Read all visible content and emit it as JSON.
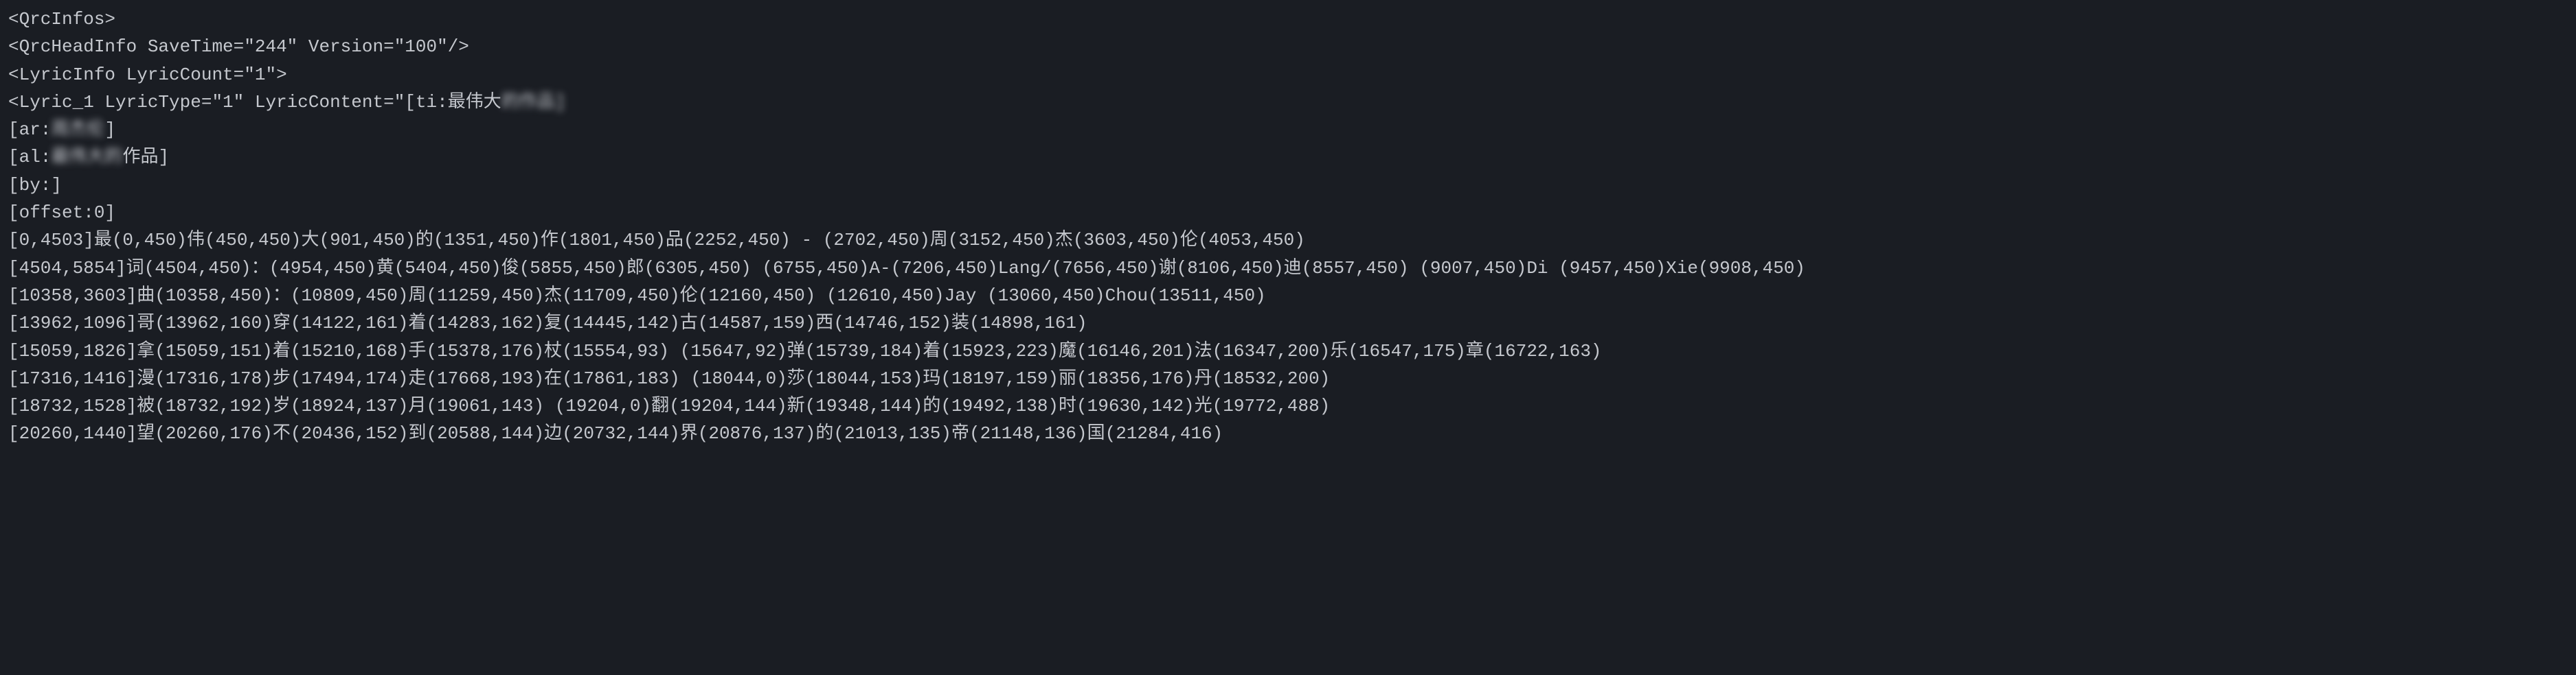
{
  "lines": {
    "l1": "<QrcInfos>",
    "l2": "<QrcHeadInfo SaveTime=\"244\" Version=\"100\"/>",
    "l3": "<LyricInfo LyricCount=\"1\">",
    "l4a": "<Lyric_1 LyricType=\"1\" LyricContent=\"[ti:最伟大",
    "l4b": "的作品]",
    "l5a": "[ar:",
    "l5b": "周杰伦",
    "l5c": "]",
    "l6a": "[al:",
    "l6b": "最伟大的",
    "l6c": "作品]",
    "l7": "[by:]",
    "l8": "[offset:0]",
    "l9": "[0,4503]最(0,450)伟(450,450)大(901,450)的(1351,450)作(1801,450)品(2252,450) - (2702,450)周(3152,450)杰(3603,450)伦(4053,450)",
    "l10": "[4504,5854]词(4504,450)：(4954,450)黄(5404,450)俊(5855,450)郎(6305,450) (6755,450)A-(7206,450)Lang/(7656,450)谢(8106,450)迪(8557,450) (9007,450)Di (9457,450)Xie(9908,450)",
    "l11": "[10358,3603]曲(10358,450)：(10809,450)周(11259,450)杰(11709,450)伦(12160,450) (12610,450)Jay (13060,450)Chou(13511,450)",
    "l12": "[13962,1096]哥(13962,160)穿(14122,161)着(14283,162)复(14445,142)古(14587,159)西(14746,152)装(14898,161)",
    "l13": "[15059,1826]拿(15059,151)着(15210,168)手(15378,176)杖(15554,93) (15647,92)弹(15739,184)着(15923,223)魔(16146,201)法(16347,200)乐(16547,175)章(16722,163)",
    "l14": "[17316,1416]漫(17316,178)步(17494,174)走(17668,193)在(17861,183) (18044,0)莎(18044,153)玛(18197,159)丽(18356,176)丹(18532,200)",
    "l15": "[18732,1528]被(18732,192)岁(18924,137)月(19061,143) (19204,0)翻(19204,144)新(19348,144)的(19492,138)时(19630,142)光(19772,488)",
    "l16": "[20260,1440]望(20260,176)不(20436,152)到(20588,144)边(20732,144)界(20876,137)的(21013,135)帝(21148,136)国(21284,416)"
  }
}
